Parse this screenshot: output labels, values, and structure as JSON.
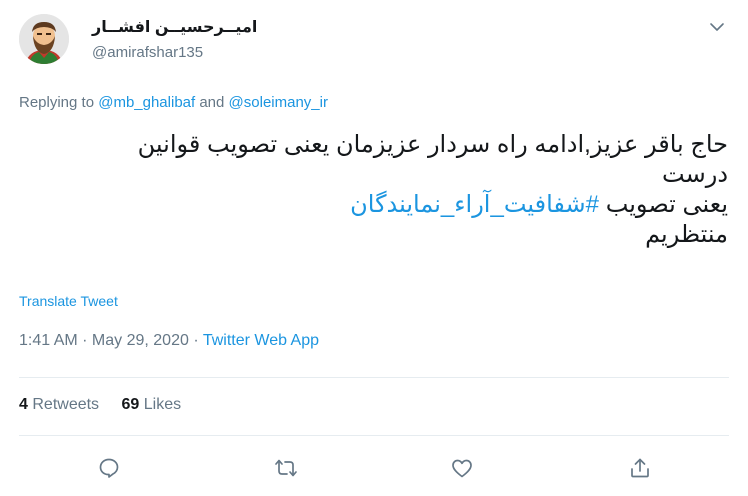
{
  "author": {
    "display_name": "امیــرحسیــن افشــار",
    "handle": "@amirafshar135"
  },
  "replying": {
    "prefix": "Replying to",
    "user1": "@mb_ghalibaf",
    "connector": "and",
    "user2": "@soleimany_ir"
  },
  "tweet": {
    "line1": "حاج باقر عزیز,ادامه راه سردار عزیزمان یعنی تصویب قوانین",
    "line2": "درست",
    "line3_prefix": "یعنی تصویب",
    "hashtag": "#شفافیت_آراء_نمایندگان",
    "line4": "منتظریم"
  },
  "translate_label": "Translate Tweet",
  "meta": {
    "time": "1:41 AM",
    "sep1": " · ",
    "date": "May 29, 2020",
    "sep2": " · ",
    "source": "Twitter Web App"
  },
  "stats": {
    "retweets_count": "4",
    "retweets_label": "Retweets",
    "likes_count": "69",
    "likes_label": "Likes"
  },
  "icons": {
    "reply": "reply-icon",
    "retweet": "retweet-icon",
    "like": "heart-icon",
    "share": "share-icon",
    "caret": "chevron-down-icon"
  },
  "colors": {
    "link": "#1b95e0",
    "muted": "#657786",
    "text": "#14171a",
    "divider": "#e6ecf0"
  }
}
